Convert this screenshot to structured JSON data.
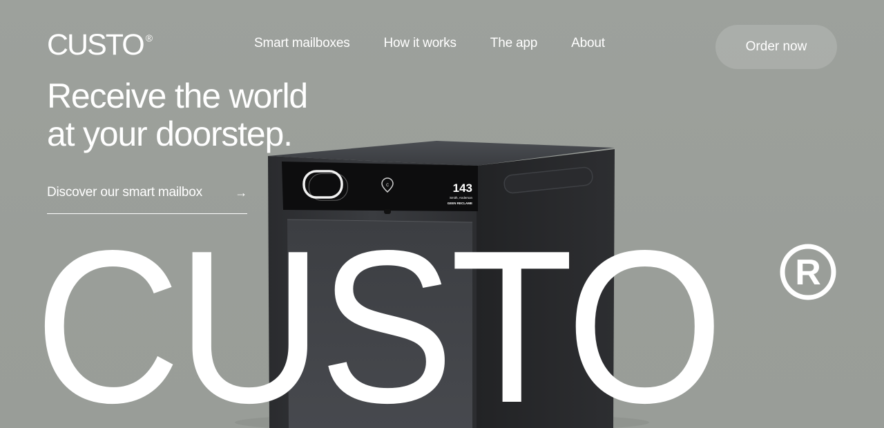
{
  "brand": {
    "logo_text": "CUSTO",
    "logo_mark": "®"
  },
  "nav": {
    "items": [
      {
        "label": "Smart mailboxes"
      },
      {
        "label": "How it works"
      },
      {
        "label": "The app"
      },
      {
        "label": "About"
      }
    ]
  },
  "header": {
    "order_button_label": "Order now"
  },
  "hero": {
    "headline_line1": "Receive the world",
    "headline_line2": "at your doorstep.",
    "cta_label": "Discover our smart mailbox",
    "cta_icon": "arrow-right-icon",
    "wordmark": "CUSTO",
    "wordmark_mark": "®"
  },
  "mailbox_display": {
    "number": "143",
    "name_line": "Smith, Anderson",
    "note_line": "GEEN RECLAME"
  },
  "colors": {
    "background": "#9b9f9a",
    "text": "#ffffff",
    "button_fill": "rgba(255,255,255,0.14)",
    "mailbox_body": "#2f3033"
  }
}
